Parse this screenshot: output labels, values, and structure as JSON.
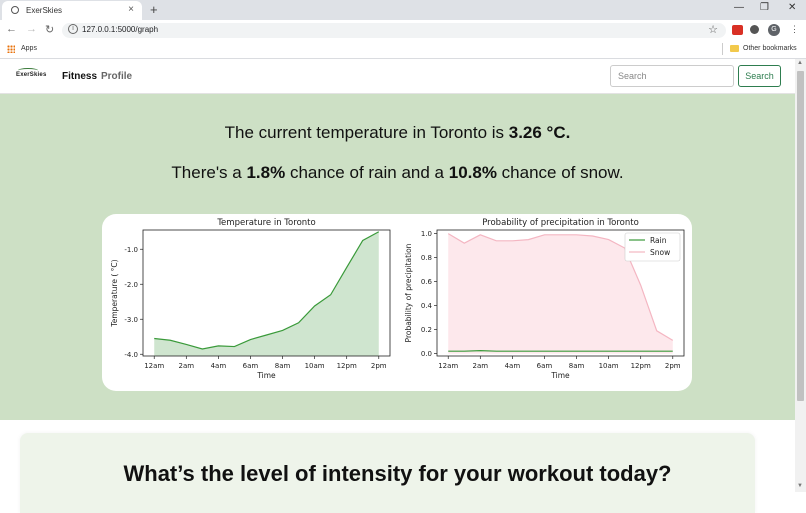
{
  "browser": {
    "tab_title": "ExerSkies",
    "tab_close": "×",
    "new_tab": "+",
    "url": "127.0.0.1:5000/graph",
    "apps_label": "Apps",
    "other_bookmarks": "Other bookmarks",
    "profile_initial": "G",
    "win_minimize": "—",
    "win_restore": "❐",
    "win_close": "✕"
  },
  "site": {
    "logo": "ExerSkies",
    "nav": {
      "fitness": "Fitness",
      "profile": "Profile"
    },
    "search": {
      "placeholder": "Search",
      "button": "Search"
    }
  },
  "weather": {
    "temp_prefix": "The current temperature in Toronto is ",
    "temp_value": "3.26 °C.",
    "rain_prefix": "There's a ",
    "rain_value": "1.8%",
    "rain_mid": " chance of rain and a ",
    "snow_value": "10.8%",
    "snow_suffix": " chance of snow."
  },
  "workout": {
    "title": "What’s the level of intensity for your workout today?"
  },
  "colors": {
    "hero_bg": "#cde0c5",
    "line_green": "#3a9a3a",
    "fill_green": "#cfe5cf",
    "snow_pink": "#f4b6c2",
    "snow_fill": "#fde8ec",
    "accent": "#2e7d4f"
  },
  "chart_data": [
    {
      "type": "area",
      "title": "Temperature in Toronto",
      "xlabel": "Time",
      "ylabel": "Temperature ( °C)",
      "x_ticks": [
        "12am",
        "2am",
        "4am",
        "6am",
        "8am",
        "10am",
        "12pm",
        "2pm"
      ],
      "y_ticks": [
        "-4.0",
        "-3.0",
        "-2.0",
        "-1.0"
      ],
      "y_tick_values": [
        -4,
        -3,
        -2,
        -1
      ],
      "ylim": [
        -4.05,
        -0.45
      ],
      "x_hours": [
        0,
        1,
        2,
        3,
        4,
        5,
        6,
        7,
        8,
        9,
        10,
        11,
        12,
        13,
        14
      ],
      "series": [
        {
          "values": [
            -3.55,
            -3.6,
            -3.72,
            -3.85,
            -3.76,
            -3.78,
            -3.58,
            -3.45,
            -3.32,
            -3.1,
            -2.62,
            -2.3,
            -1.52,
            -0.75,
            -0.5
          ]
        }
      ]
    },
    {
      "type": "area",
      "title": "Probability of precipitation in Toronto",
      "xlabel": "Time",
      "ylabel": "Probability of precipitation",
      "x_ticks": [
        "12am",
        "2am",
        "4am",
        "6am",
        "8am",
        "10am",
        "12pm",
        "2pm"
      ],
      "y_ticks": [
        "0.0",
        "0.2",
        "0.4",
        "0.6",
        "0.8",
        "1.0"
      ],
      "y_tick_values": [
        0,
        0.2,
        0.4,
        0.6,
        0.8,
        1.0
      ],
      "ylim": [
        -0.02,
        1.03
      ],
      "x_hours": [
        0,
        1,
        2,
        3,
        4,
        5,
        6,
        7,
        8,
        9,
        10,
        11,
        12,
        13,
        14
      ],
      "legend": "top-right",
      "series": [
        {
          "name": "Rain",
          "values": [
            0.02,
            0.02,
            0.025,
            0.02,
            0.02,
            0.02,
            0.02,
            0.02,
            0.02,
            0.02,
            0.02,
            0.02,
            0.02,
            0.02,
            0.02
          ]
        },
        {
          "name": "Snow",
          "values": [
            1.0,
            0.92,
            0.99,
            0.94,
            0.94,
            0.95,
            0.99,
            0.99,
            0.99,
            0.98,
            0.95,
            0.88,
            0.57,
            0.19,
            0.11
          ]
        }
      ]
    }
  ]
}
